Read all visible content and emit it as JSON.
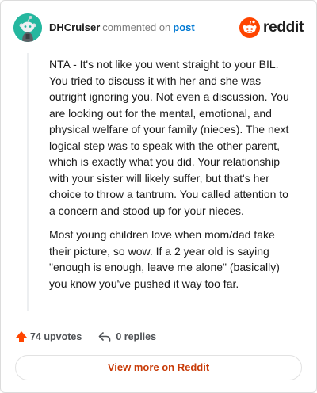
{
  "header": {
    "username": "DHCruiser",
    "action_text": "commented on",
    "post_link": "post",
    "brand_name": "reddit"
  },
  "comment": {
    "paragraphs": [
      "NTA - It's not like you went straight to your BIL. You tried to discuss it with her and she was outright ignoring you. Not even a discussion. You are looking out for the mental, emotional, and physical welfare of your family (nieces). The next logical step was to speak with the other parent, which is exactly what you did. Your relationship with your sister will likely suffer, but that's her choice to throw a tantrum. You called attention to a concern and stood up for your nieces.",
      "Most young children love when mom/dad take their picture, so wow. If a 2 year old is saying \"enough is enough, leave me alone\" (basically) you know you've pushed it way too far."
    ]
  },
  "footer": {
    "upvotes": "74 upvotes",
    "replies": "0 replies"
  },
  "actions": {
    "view_more": "View more on Reddit"
  },
  "colors": {
    "avatar_bg": "#25b79f",
    "brand_orange": "#ff4500",
    "link_blue": "#0079d3",
    "view_more_text": "#c83b08"
  },
  "icons": {
    "avatar": "snoo-avatar-icon",
    "brand": "reddit-logo-icon",
    "upvote": "upvote-arrow-icon",
    "reply": "reply-arrow-icon"
  }
}
